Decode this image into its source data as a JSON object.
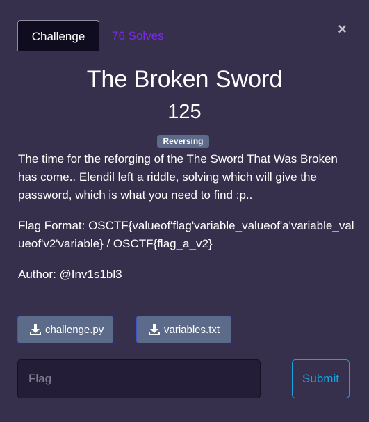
{
  "tabs": {
    "challenge": "Challenge",
    "solves": "76 Solves"
  },
  "close_icon": "×",
  "challenge": {
    "name": "The Broken Sword",
    "points": "125",
    "category": "Reversing",
    "description": [
      "The time for the reforging of the The Sword That Was Broken has come.. Elendil left a riddle, solving which will give the password, which is what you need to find :p..",
      "Flag Format: OSCTF{valueof'flag'variable_valueof'a'variable_valueof'v2'variable} / OSCTF{flag_a_v2}",
      "Author: @Inv1s1bl3"
    ],
    "files": [
      {
        "label": "challenge.py",
        "icon": "download-icon"
      },
      {
        "label": "variables.txt",
        "icon": "download-icon"
      }
    ]
  },
  "form": {
    "flag_placeholder": "Flag",
    "flag_value": "",
    "submit_label": "Submit"
  },
  "colors": {
    "background": "#37304c",
    "active_tab": "#100c1f",
    "solves_link": "#7a2be2",
    "badge": "#5d6b8a",
    "submit": "#1aa2e0"
  }
}
